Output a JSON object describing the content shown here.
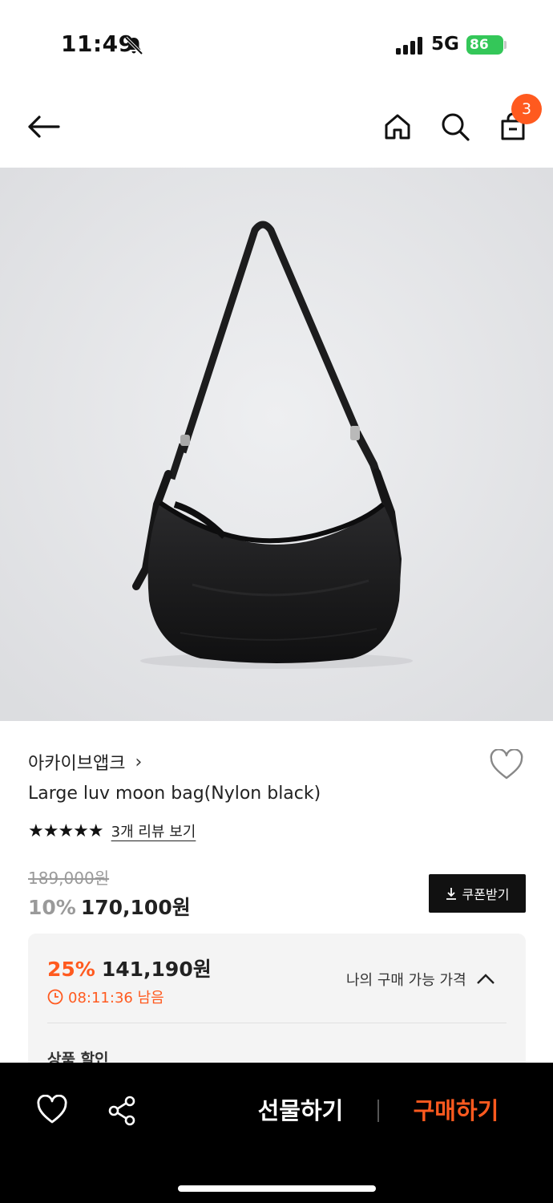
{
  "status_bar": {
    "time": "11:49",
    "network": "5G",
    "battery": "86"
  },
  "header": {
    "cart_count": "3",
    "icons": [
      "back-arrow-icon",
      "home-icon",
      "search-icon",
      "cart-icon"
    ]
  },
  "product": {
    "brand": "아카이브앱크",
    "brand_chevron": "›",
    "name": "Large luv moon bag(Nylon black)",
    "stars": "★★★★★",
    "rating": 5,
    "review_link": "3개 리뷰 보기",
    "original_price": "189,000원",
    "discount_rate": "10%",
    "sale_price": "170,100원",
    "coupon_button": "쿠폰받기"
  },
  "price_card": {
    "discount_rate": "25%",
    "final_price": "141,190원",
    "timer": "08:11:36 남음",
    "my_price_toggle": "나의 구매 가능 가격",
    "section_label": "상품 할인"
  },
  "bottom_bar": {
    "gift_button": "선물하기",
    "buy_button": "구매하기"
  },
  "colors": {
    "accent": "#ff5a1f",
    "image_bg": "#e7e8ea",
    "bottom_bar": "#000000",
    "battery": "#34c759"
  }
}
